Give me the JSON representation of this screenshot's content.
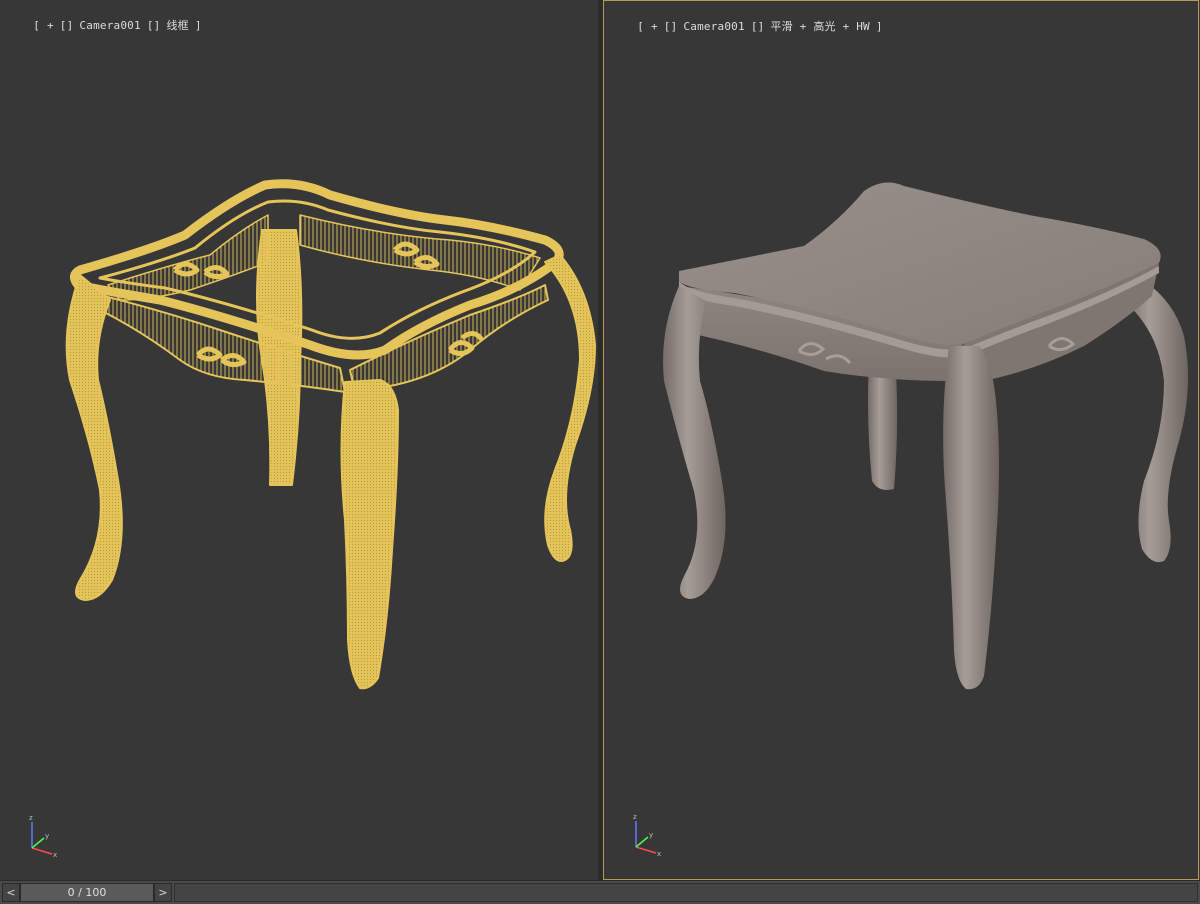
{
  "viewports": {
    "left": {
      "label_parts": [
        "[ +",
        "[]",
        "Camera001",
        "[]",
        "线框",
        "]"
      ],
      "render_mode": "wireframe",
      "object_color": "#e5c45a"
    },
    "right": {
      "label_parts": [
        "[ +",
        "[]",
        "Camera001",
        "[]",
        "平滑 + 高光 + HW",
        "]"
      ],
      "render_mode": "smooth-highlights",
      "object_color": "#8e8480",
      "active": true
    }
  },
  "axis_gizmo": {
    "x": "x",
    "y": "y",
    "z": "z"
  },
  "timeline": {
    "frame_display": "0 / 100",
    "prev_label": "<",
    "next_label": ">"
  },
  "colors": {
    "viewport_bg": "#373737",
    "active_border": "#b39b55",
    "wire": "#e5c45a",
    "solid": "#8e8480"
  }
}
